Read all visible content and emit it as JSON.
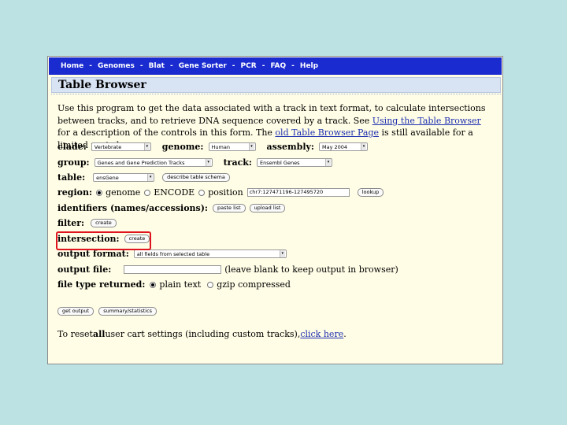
{
  "nav": {
    "items": [
      "Home",
      "Genomes",
      "Blat",
      "Gene Sorter",
      "PCR",
      "FAQ",
      "Help"
    ],
    "separator": "-"
  },
  "page_title": "Table Browser",
  "intro": {
    "text1": "Use this program to get the data associated with a track in text format, to calculate intersections between tracks, and to retrieve DNA sequence covered by a track. See ",
    "link1": "Using the Table Browser",
    "text2": " for a description of the controls in this form. The ",
    "link2": "old Table Browser Page",
    "text3": " is still available for a limited period."
  },
  "clade": {
    "label": "clade:",
    "value": "Vertebrate"
  },
  "genome": {
    "label": "genome:",
    "value": "Human"
  },
  "assembly": {
    "label": "assembly:",
    "value": "May 2004"
  },
  "group": {
    "label": "group:",
    "value": "Genes and Gene Prediction Tracks"
  },
  "track": {
    "label": "track:",
    "value": "Ensembl Genes"
  },
  "table": {
    "label": "table:",
    "value": "ensGene",
    "schema_button": "describe table schema"
  },
  "region": {
    "label": "region:",
    "opt_genome": "genome",
    "opt_encode": "ENCODE",
    "opt_position": "position",
    "position_value": "chr7:127471196-127495720",
    "lookup_button": "lookup"
  },
  "identifiers": {
    "label": "identifiers (names/accessions):",
    "paste_button": "paste list",
    "upload_button": "upload list"
  },
  "filter": {
    "label": "filter:",
    "button": "create"
  },
  "intersection": {
    "label": "intersection:",
    "button": "create"
  },
  "output_format": {
    "label": "output format:",
    "value": "all fields from selected table"
  },
  "output_file": {
    "label": "output file:",
    "value": "",
    "note": "(leave blank to keep output in browser)"
  },
  "file_type": {
    "label": "file type returned:",
    "opt_plain": "plain text",
    "opt_gzip": "gzip compressed"
  },
  "actions": {
    "get_output": "get output",
    "summary": "summary/statistics"
  },
  "reset": {
    "text1": "To reset ",
    "all": "all",
    "text2": " user cart settings (including custom tracks), ",
    "link": "click here",
    "text3": "."
  },
  "colors": {
    "nav_bg": "#1a2bd0",
    "page_bg": "#fffde6",
    "highlight": "#e0141e",
    "link": "#1d2fb0",
    "outer_bg": "#bde2e4"
  }
}
